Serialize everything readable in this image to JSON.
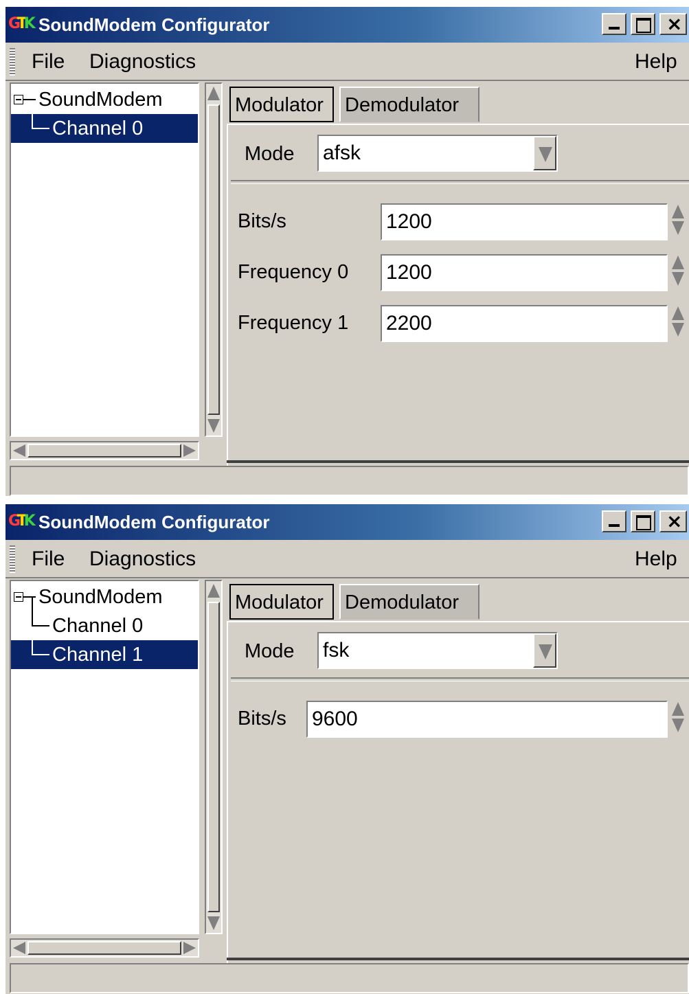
{
  "windows": [
    {
      "title": "SoundModem Configurator",
      "menu": {
        "file": "File",
        "diagnostics": "Diagnostics",
        "help": "Help"
      },
      "tree": {
        "root": "SoundModem",
        "channels": [
          "Channel 0"
        ],
        "selected_index": 0
      },
      "tabs": {
        "modulator": "Modulator",
        "demodulator": "Demodulator"
      },
      "mode": {
        "label": "Mode",
        "value": "afsk"
      },
      "fields": [
        {
          "label": "Bits/s",
          "value": "1200"
        },
        {
          "label": "Frequency 0",
          "value": "1200"
        },
        {
          "label": "Frequency 1",
          "value": "2200"
        }
      ]
    },
    {
      "title": "SoundModem Configurator",
      "menu": {
        "file": "File",
        "diagnostics": "Diagnostics",
        "help": "Help"
      },
      "tree": {
        "root": "SoundModem",
        "channels": [
          "Channel 0",
          "Channel 1"
        ],
        "selected_index": 1
      },
      "tabs": {
        "modulator": "Modulator",
        "demodulator": "Demodulator"
      },
      "mode": {
        "label": "Mode",
        "value": "fsk"
      },
      "fields": [
        {
          "label": "Bits/s",
          "value": "9600"
        }
      ]
    }
  ],
  "icons": {
    "app": "gtk-logo-icon",
    "minimize": "minimize-icon",
    "maximize": "maximize-icon",
    "close": "close-icon",
    "expander": "tree-collapse-icon",
    "combo": "chevron-down-icon",
    "spin": "spin-arrows-icon"
  },
  "colors": {
    "selection": "#0a246a",
    "titlebar_start": "#0a246a",
    "titlebar_end": "#a6caf0",
    "face": "#d4d0c8"
  }
}
